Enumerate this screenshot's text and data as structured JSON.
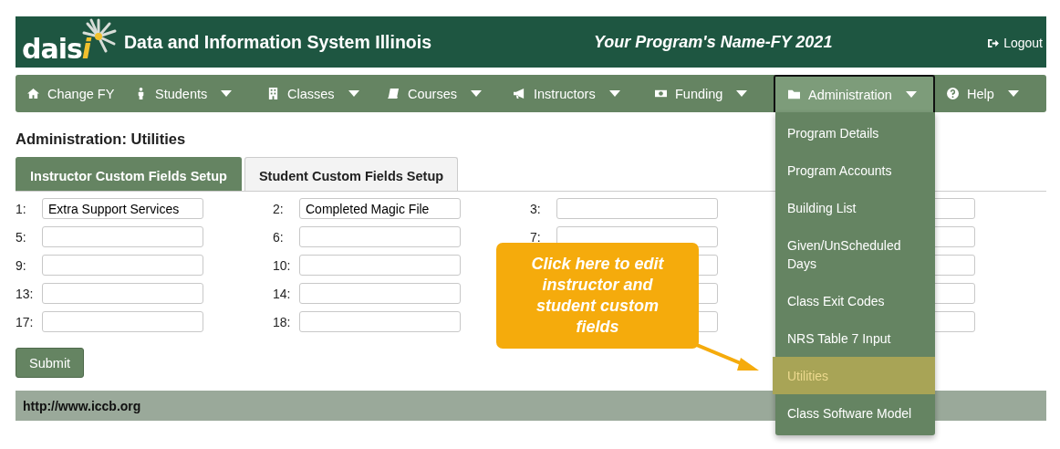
{
  "header": {
    "logo": {
      "text": "dais",
      "accent": "i"
    },
    "title": "Data and Information System Illinois",
    "program": "Your Program's Name-FY 2021",
    "logout": "Logout"
  },
  "nav": [
    {
      "label": "Change FY",
      "dropdown": false,
      "selected": false
    },
    {
      "label": "Students",
      "dropdown": true,
      "selected": false
    },
    {
      "label": "Classes",
      "dropdown": true,
      "selected": false
    },
    {
      "label": "Courses",
      "dropdown": true,
      "selected": false
    },
    {
      "label": "Instructors",
      "dropdown": true,
      "selected": false
    },
    {
      "label": "Funding",
      "dropdown": true,
      "selected": false
    },
    {
      "label": "Administration",
      "dropdown": true,
      "selected": true,
      "menu": [
        {
          "label": "Program Details",
          "selected": false
        },
        {
          "label": "Program Accounts",
          "selected": false
        },
        {
          "label": "Building List",
          "selected": false
        },
        {
          "label": "Given/UnScheduled Days",
          "selected": false
        },
        {
          "label": "Class Exit Codes",
          "selected": false
        },
        {
          "label": "NRS Table 7 Input",
          "selected": false
        },
        {
          "label": "Utilities",
          "selected": true
        },
        {
          "label": "Class Software Model",
          "selected": false
        }
      ]
    },
    {
      "label": "Help",
      "dropdown": true,
      "selected": false
    }
  ],
  "page_title": "Administration: Utilities",
  "tabs": [
    {
      "label": "Instructor Custom Fields Setup",
      "selected": true
    },
    {
      "label": "Student Custom Fields Setup",
      "selected": false
    }
  ],
  "fields": [
    [
      {
        "label": "1:",
        "value": "Extra Support Services"
      },
      {
        "label": "2:",
        "value": "Completed Magic File"
      },
      {
        "label": "3:"
      }
    ],
    [
      {
        "label": "5:"
      },
      {
        "label": "6:"
      },
      {
        "label": "7:"
      }
    ],
    [
      {
        "label": "9:"
      },
      {
        "label": "10:"
      }
    ],
    [
      {
        "label": "13:"
      },
      {
        "label": "14:"
      }
    ],
    [
      {
        "label": "17:"
      },
      {
        "label": "18:"
      }
    ]
  ],
  "submit": "Submit",
  "callout": "Click here to edit instructor and student custom fields",
  "footer": "http://www.iccb.org"
}
